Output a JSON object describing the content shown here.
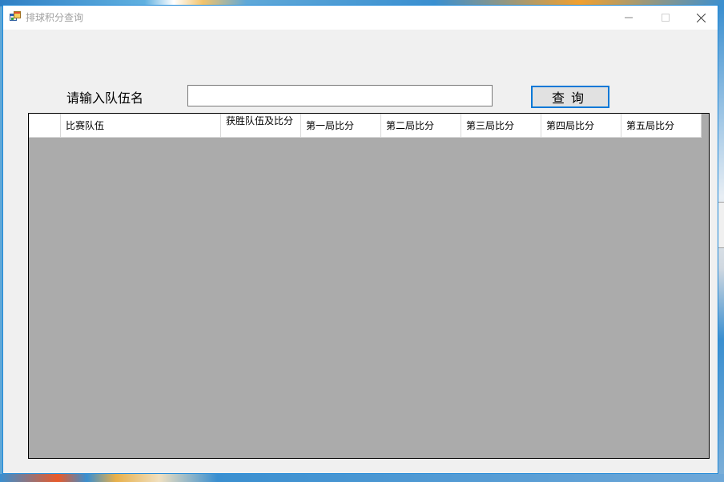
{
  "window": {
    "title": "排球积分查询",
    "icon": "app-window-icon"
  },
  "search": {
    "label": "请输入队伍名",
    "value": "",
    "placeholder": ""
  },
  "query_button": {
    "label": "查询"
  },
  "grid": {
    "columns": [
      "比赛队伍",
      "获胜队伍及比分",
      "第一局比分",
      "第二局比分",
      "第三局比分",
      "第四局比分",
      "第五局比分"
    ],
    "rows": []
  },
  "colors": {
    "accent": "#0078d7",
    "grid_background": "#ababab",
    "window_background": "#f0f0f0"
  }
}
